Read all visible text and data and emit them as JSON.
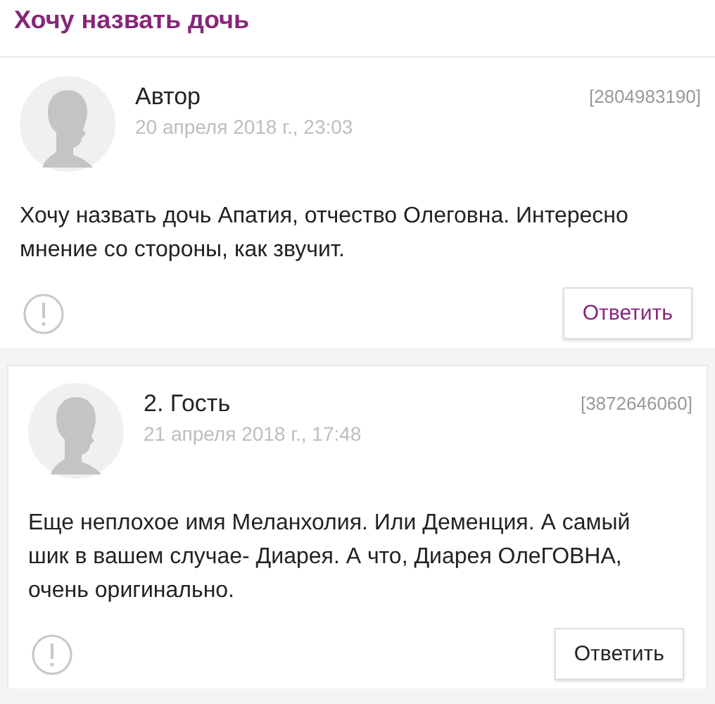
{
  "topic": {
    "title": "Хочу назвать дочь"
  },
  "posts": [
    {
      "author": "Автор",
      "date": "20 апреля 2018 г., 23:03",
      "id": "[2804983190]",
      "text": "Хочу назвать дочь Апатия, отчество Олеговна. Интересно мнение со стороны, как звучит.",
      "reply": {
        "label": "Ответить",
        "highlighted": true
      },
      "boxed": false
    },
    {
      "author": "2. Гость",
      "date": "21 апреля 2018 г., 17:48",
      "id": "[3872646060]",
      "text": "Еще неплохое имя Меланхолия. Или Деменция. А самый шик в вашем случае- Диарея. А что, Диарея ОлеГОВНА, очень оригинально.",
      "reply": {
        "label": "Ответить",
        "highlighted": false
      },
      "boxed": true
    }
  ]
}
